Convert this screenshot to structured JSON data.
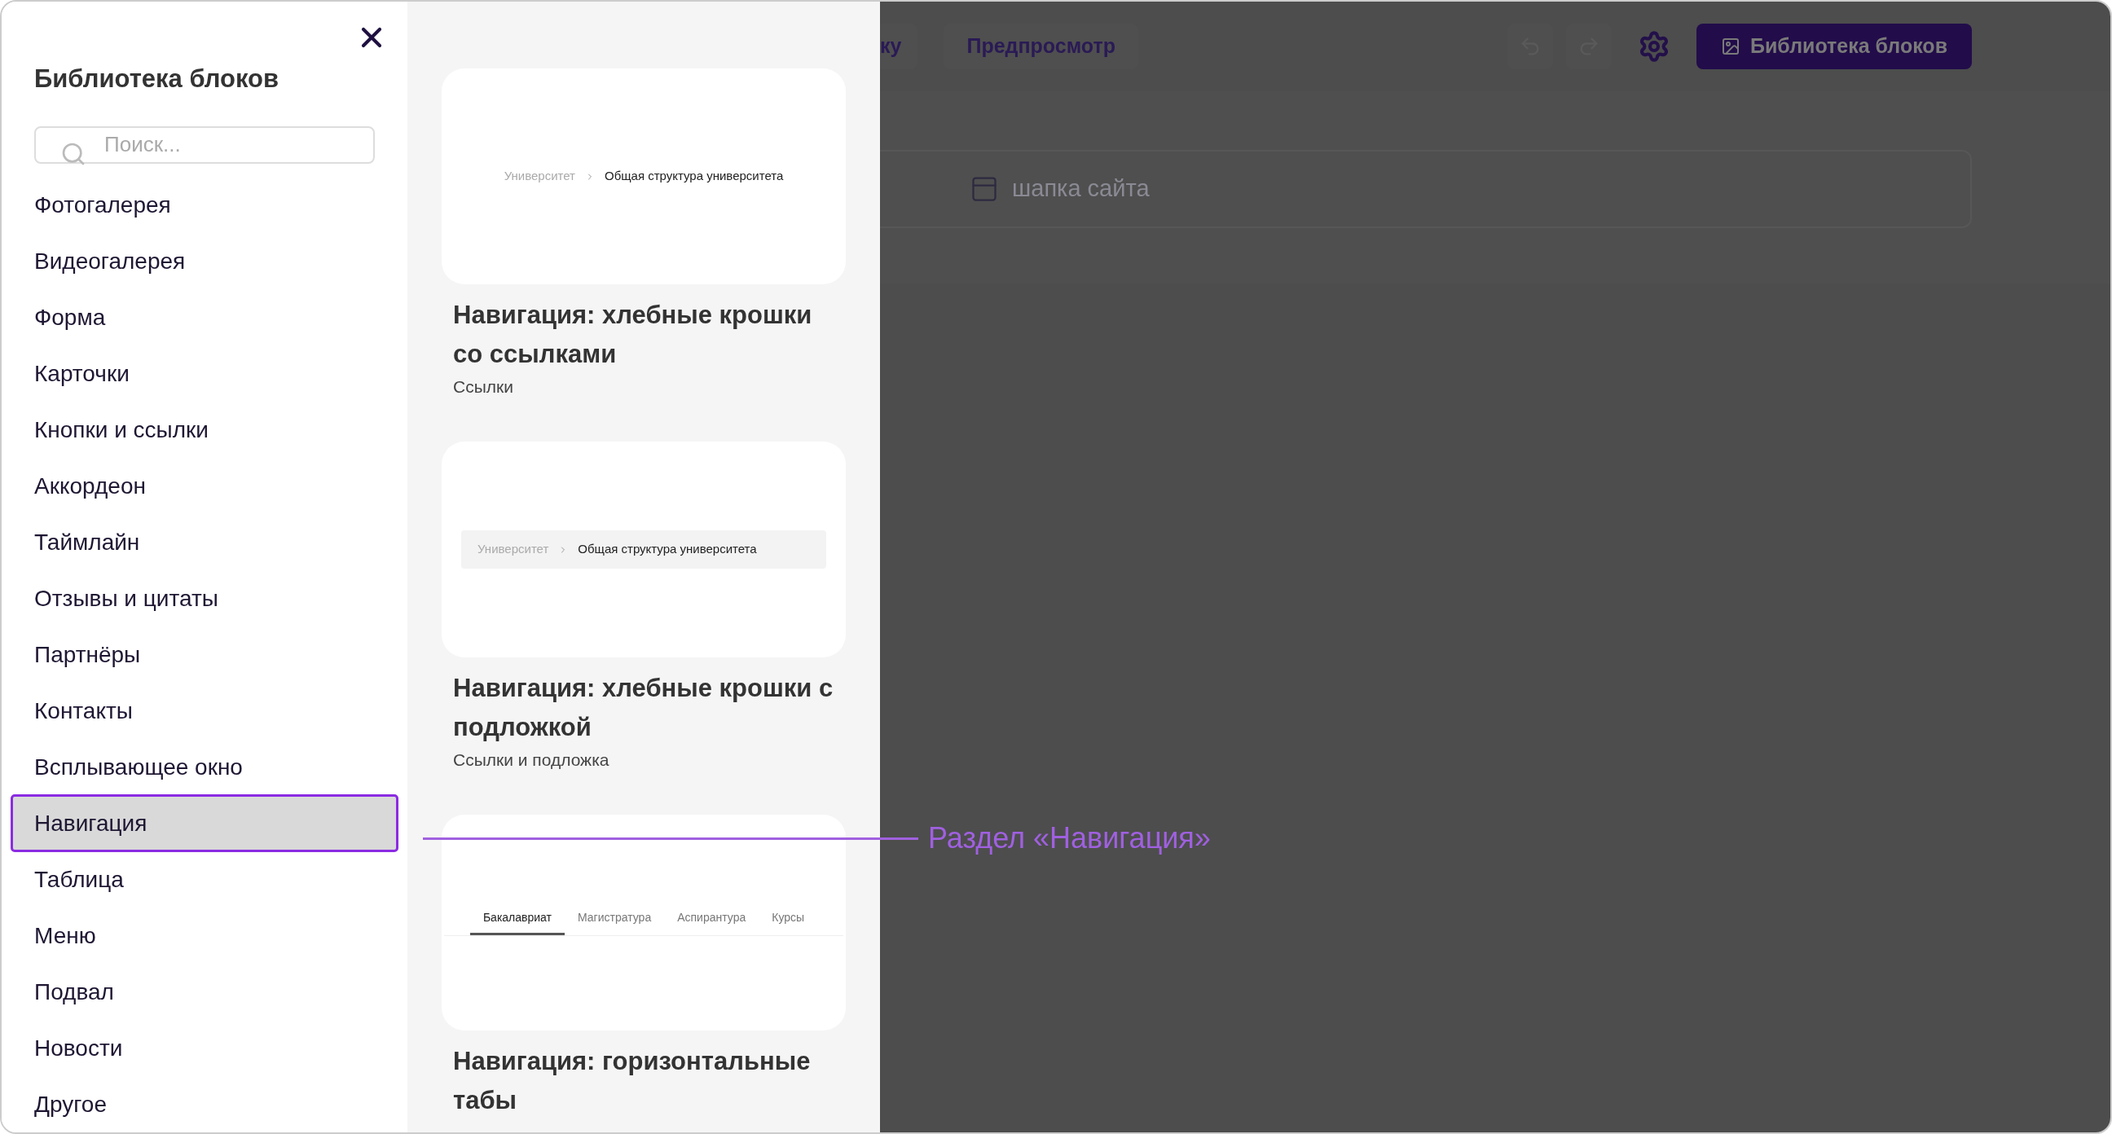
{
  "sidebar": {
    "title": "Библиотека блоков",
    "search": {
      "placeholder": "Поиск..."
    },
    "items": [
      {
        "label": "Фотогалерея",
        "selected": false
      },
      {
        "label": "Видеогалерея",
        "selected": false
      },
      {
        "label": "Форма",
        "selected": false
      },
      {
        "label": "Карточки",
        "selected": false
      },
      {
        "label": "Кнопки и ссылки",
        "selected": false
      },
      {
        "label": "Аккордеон",
        "selected": false
      },
      {
        "label": "Таймлайн",
        "selected": false
      },
      {
        "label": "Отзывы и цитаты",
        "selected": false
      },
      {
        "label": "Партнёры",
        "selected": false
      },
      {
        "label": "Контакты",
        "selected": false
      },
      {
        "label": "Всплывающее окно",
        "selected": false
      },
      {
        "label": "Навигация",
        "selected": true
      },
      {
        "label": "Таблица",
        "selected": false
      },
      {
        "label": "Меню",
        "selected": false
      },
      {
        "label": "Подвал",
        "selected": false
      },
      {
        "label": "Новости",
        "selected": false
      },
      {
        "label": "Другое",
        "selected": false
      }
    ]
  },
  "cards": [
    {
      "kind": "breadcrumbs",
      "crumbs": [
        "Университет",
        "Общая структура университета"
      ],
      "title": "Навигация: хлебные крошки со ссылками",
      "subtitle": "Ссылки"
    },
    {
      "kind": "breadcrumbs_bg",
      "crumbs": [
        "Университет",
        "Общая структура университета"
      ],
      "title": "Навигация: хлебные крошки с подложкой",
      "subtitle": "Ссылки и подложка"
    },
    {
      "kind": "tabs",
      "tabs": [
        {
          "label": "Бакалавриат",
          "selected": true
        },
        {
          "label": "Магистратура",
          "selected": false
        },
        {
          "label": "Аспирантура",
          "selected": false
        },
        {
          "label": "Курсы",
          "selected": false
        }
      ],
      "title": "Навигация: горизонтальные табы"
    }
  ],
  "editor": {
    "partial_button": "ку",
    "preview_button": "Предпросмотр",
    "library_button": "Библиотека блоков",
    "header_block": "шапка сайта"
  },
  "annotation": {
    "label": "Раздел «Навигация»"
  }
}
